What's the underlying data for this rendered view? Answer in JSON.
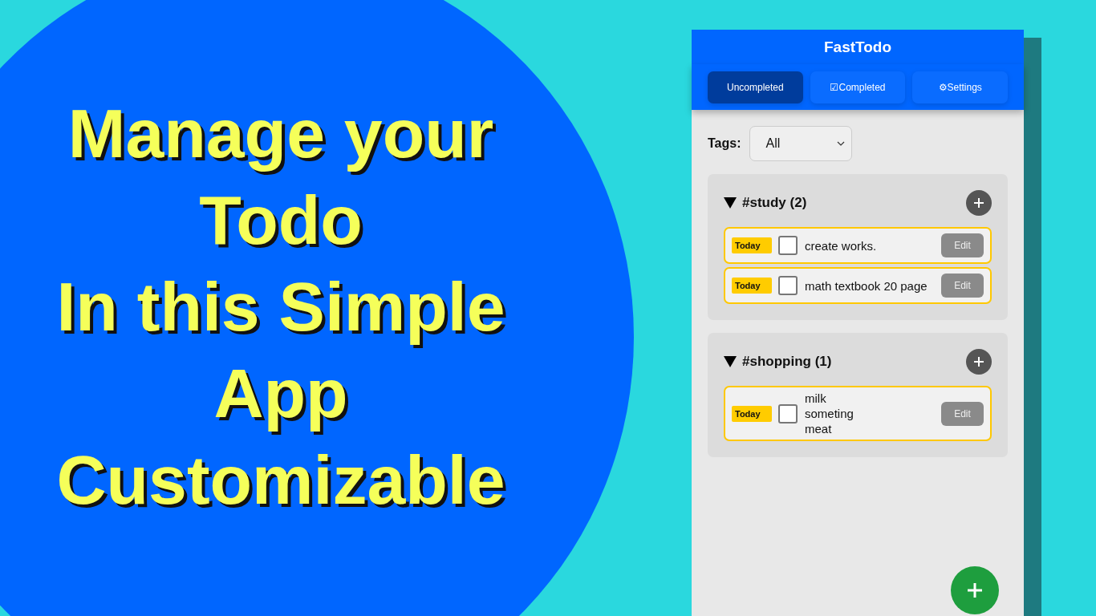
{
  "headline": [
    "Manage your",
    "Todo",
    "In this Simple",
    "App",
    "Customizable"
  ],
  "app": {
    "title": "FastTodo",
    "tabs": [
      {
        "label": "Uncompleted",
        "selected": true
      },
      {
        "label": "☑Completed",
        "selected": false
      },
      {
        "label": "⚙Settings",
        "selected": false
      }
    ],
    "tags_filter": {
      "label": "Tags:",
      "value": "All"
    },
    "groups": [
      {
        "title": "#study (2)",
        "expanded": true,
        "todos": [
          {
            "due": "Today",
            "checked": false,
            "text": "create works.",
            "edit": "Edit"
          },
          {
            "due": "Today",
            "checked": false,
            "text": "math textbook 20 page",
            "edit": "Edit"
          }
        ]
      },
      {
        "title": "#shopping (1)",
        "expanded": true,
        "todos": [
          {
            "due": "Today",
            "checked": false,
            "text": "milk\nsometing\nmeat",
            "edit": "Edit"
          }
        ]
      }
    ]
  }
}
